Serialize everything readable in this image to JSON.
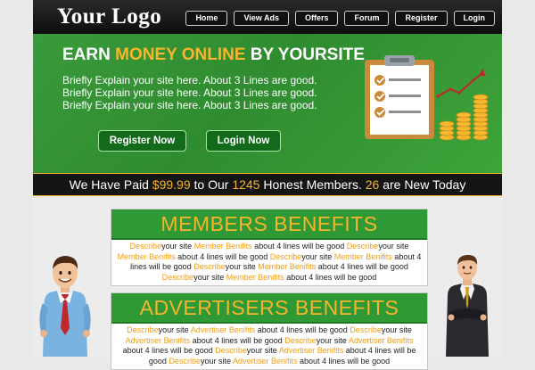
{
  "header": {
    "logo": "Your Logo",
    "nav": [
      "Home",
      "View Ads",
      "Offers",
      "Forum",
      "Register",
      "Login"
    ]
  },
  "hero": {
    "title_pre": "EARN ",
    "title_accent": "MONEY ONLINE",
    "title_post": " BY YOURSITE",
    "text": "Briefly Explain your site here. About 3 Lines are good. Briefly Explain your site here. About 3 Lines are good. Briefly Explain your site here. About 3 Lines are good.",
    "register_label": "Register Now",
    "login_label": "Login Now"
  },
  "stats": {
    "pre": "We Have Paid ",
    "paid": "$99.99",
    "mid": " to Our ",
    "members": "1245",
    "mid2": " Honest Members. ",
    "new_count": "26",
    "post": " are New Today"
  },
  "members_box": {
    "title": "MEMBERS BENEFITS",
    "segments": [
      {
        "t": "Describe",
        "o": true
      },
      {
        "t": "your site ",
        "o": false
      },
      {
        "t": "Member Benifits",
        "o": true
      },
      {
        "t": " about 4 lines will be good ",
        "o": false
      },
      {
        "t": "Describe",
        "o": true
      },
      {
        "t": "your site ",
        "o": false
      },
      {
        "t": "Member Benifits",
        "o": true
      },
      {
        "t": " about 4 lines will be good ",
        "o": false
      },
      {
        "t": "Describe",
        "o": true
      },
      {
        "t": "your site ",
        "o": false
      },
      {
        "t": "Member Benifits",
        "o": true
      },
      {
        "t": " about 4 lines will be good ",
        "o": false
      },
      {
        "t": "Describe",
        "o": true
      },
      {
        "t": "your site ",
        "o": false
      },
      {
        "t": "Member Benifits",
        "o": true
      },
      {
        "t": " about 4 lines will be good ",
        "o": false
      },
      {
        "t": "Describe",
        "o": true
      },
      {
        "t": "your site ",
        "o": false
      },
      {
        "t": "Member Benifits",
        "o": true
      },
      {
        "t": " about 4 lines will be good",
        "o": false
      }
    ]
  },
  "advertisers_box": {
    "title": "ADVERTISERS BENEFITS",
    "segments": [
      {
        "t": "Describe",
        "o": true
      },
      {
        "t": "your site ",
        "o": false
      },
      {
        "t": "Advertiser Benifits",
        "o": true
      },
      {
        "t": " about 4 lines will be good ",
        "o": false
      },
      {
        "t": "Describe",
        "o": true
      },
      {
        "t": "your site ",
        "o": false
      },
      {
        "t": "Advertiser Benifits",
        "o": true
      },
      {
        "t": " about 4 lines will be good ",
        "o": false
      },
      {
        "t": "Describe",
        "o": true
      },
      {
        "t": "your site ",
        "o": false
      },
      {
        "t": "Advertiser Benifits",
        "o": true
      },
      {
        "t": " about 4 lines will be good ",
        "o": false
      },
      {
        "t": "Describe",
        "o": true
      },
      {
        "t": "your site ",
        "o": false
      },
      {
        "t": "Advertiser Benifits",
        "o": true
      },
      {
        "t": " about 4 lines will be good ",
        "o": false
      },
      {
        "t": "Describe",
        "o": true
      },
      {
        "t": "your site ",
        "o": false
      },
      {
        "t": "Advertiser Benifits",
        "o": true
      },
      {
        "t": " about 4 lines will be good",
        "o": false
      }
    ]
  },
  "colors": {
    "accent": "#f7b42c",
    "green": "#2e9935",
    "dark": "#111111",
    "link_orange": "#f39c12"
  },
  "icons": [
    "clipboard-checklist-icon",
    "growth-arrow-icon",
    "coin-stack-icon"
  ]
}
